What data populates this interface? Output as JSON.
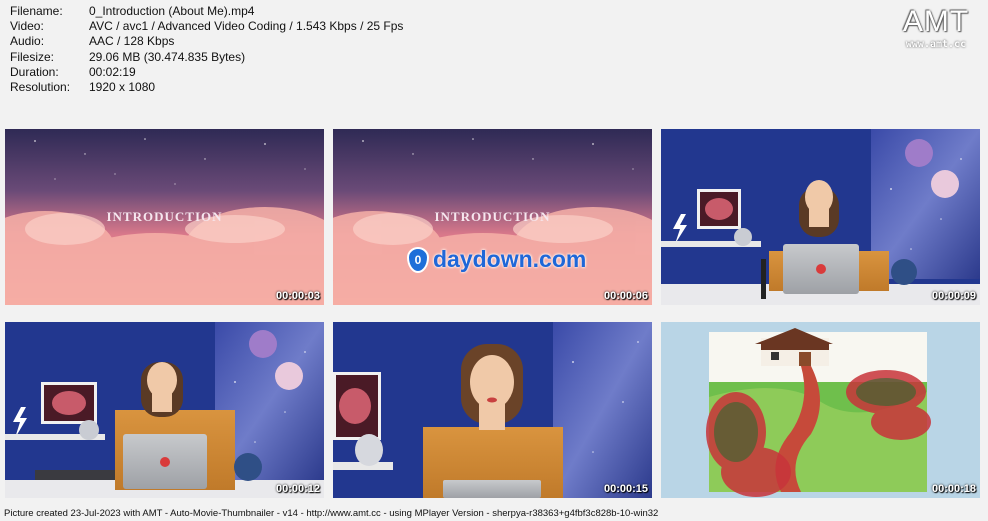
{
  "info": [
    {
      "label": "Filename:",
      "value": "0_Introduction (About Me).mp4"
    },
    {
      "label": "Video:",
      "value": "AVC / avc1 / Advanced Video Coding / 1.543 Kbps / 25 Fps"
    },
    {
      "label": "Audio:",
      "value": "AAC / 128 Kbps"
    },
    {
      "label": "Filesize:",
      "value": "29.06 MB (30.474.835 Bytes)"
    },
    {
      "label": "Duration:",
      "value": "00:02:19"
    },
    {
      "label": "Resolution:",
      "value": "1920 x 1080"
    }
  ],
  "logo": {
    "mark": "AMT",
    "url": "www.amt.cc"
  },
  "thumbnails": [
    {
      "timestamp": "00:00:03",
      "scene": "intro",
      "title": "INTRODUCTION"
    },
    {
      "timestamp": "00:00:06",
      "scene": "intro",
      "title": "INTRODUCTION",
      "watermark": "daydown.com",
      "watermark_icon": "0"
    },
    {
      "timestamp": "00:00:09",
      "scene": "studio-wide"
    },
    {
      "timestamp": "00:00:12",
      "scene": "studio-wide"
    },
    {
      "timestamp": "00:00:15",
      "scene": "studio-close"
    },
    {
      "timestamp": "00:00:18",
      "scene": "painting"
    }
  ],
  "footer": "Picture created 23-Jul-2023 with AMT - Auto-Movie-Thumbnailer - v14 - http://www.amt.cc - using MPlayer Version - sherpya-r38363+g4fbf3c828b-10-win32",
  "colors": {
    "background": "#f2f2f2",
    "studio_wall": "#22378f",
    "sky_pink": "#ef8b8e",
    "sky_purple": "#3e3563"
  }
}
